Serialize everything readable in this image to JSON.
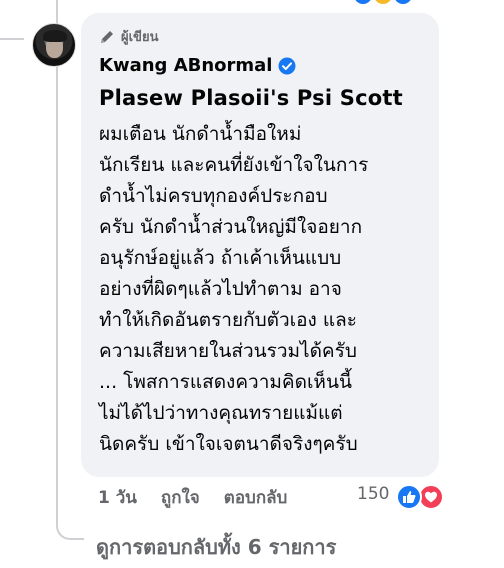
{
  "colors": {
    "bubble_bg": "#f0f2f5",
    "secondary_text": "#65676b",
    "primary_text": "#050505",
    "like_blue": "#1877f2",
    "love_red": "#f33e58",
    "thread_line": "#ced0d4"
  },
  "comment": {
    "author_badge": "ผู้เขียน",
    "author_name": "Kwang ABnormal",
    "verified_icon": "verified-badge-icon",
    "mention": "Plasew Plasoii's Psi Scott",
    "lines": [
      "ผมเตือน นักดำน้ำมือใหม่",
      "นักเรียน และคนที่ยังเข้าใจในการ",
      "ดำน้ำไม่ครบทุกองค์ประกอบ",
      "ครับ นักดำน้ำส่วนใหญ่มีใจอยาก",
      "อนุรักษ์อยู่แล้ว ถ้าเค้าเห็นแบบ",
      "อย่างที่ผิดๆแล้วไปทำตาม อาจ",
      "ทำให้เกิดอันตรายกับตัวเอง และ",
      "ความเสียหายในส่วนรวมได้ครับ",
      "... โพสการแสดงความคิดเห็นนี้",
      "ไม่ได้ไปว่าทางคุณทรายแม้แต่",
      "นิดครับ เข้าใจเจตนาดีจริงๆครับ"
    ]
  },
  "actions": {
    "time": "1 วัน",
    "like_label": "ถูกใจ",
    "reply_label": "ตอบกลับ",
    "reaction_count": "150"
  },
  "view_replies": "ดูการตอบกลับทั้ง 6 รายการ"
}
